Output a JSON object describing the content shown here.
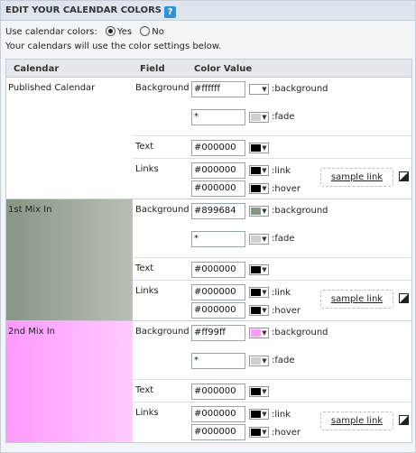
{
  "header": {
    "title": "EDIT YOUR CALENDAR COLORS",
    "help_icon": "?"
  },
  "use_colors": {
    "label": "Use calendar colors:",
    "yes": "Yes",
    "no": "No",
    "selected": "Yes"
  },
  "note": "Your calendars will use the color settings below.",
  "columns": {
    "calendar": "Calendar",
    "field": "Field",
    "value": "Color Value"
  },
  "field_labels": {
    "background": "Background",
    "text": "Text",
    "links": "Links"
  },
  "suffix": {
    "background": ":background",
    "fade": ":fade",
    "link": ":link",
    "hover": ":hover"
  },
  "sample_link": "sample link",
  "calendars": [
    {
      "name": "Published Calendar",
      "background": "#ffffff",
      "fade": "*",
      "text": "#000000",
      "link": "#000000",
      "hover": "#000000",
      "swatch_background": "#ffffff",
      "swatch_fade": "#cfcfcf",
      "swatch_text": "#000000",
      "swatch_link": "#000000",
      "swatch_hover": "#000000",
      "gradient": [
        "#ffffff",
        "#ffffff"
      ]
    },
    {
      "name": "1st Mix In",
      "background": "#899684",
      "fade": "*",
      "text": "#000000",
      "link": "#000000",
      "hover": "#000000",
      "swatch_background": "#899684",
      "swatch_fade": "#cfcfcf",
      "swatch_text": "#000000",
      "swatch_link": "#000000",
      "swatch_hover": "#000000",
      "gradient": [
        "#899684",
        "#b9bfb5"
      ]
    },
    {
      "name": "2nd Mix In",
      "background": "#ff99ff",
      "fade": "*",
      "text": "#000000",
      "link": "#000000",
      "hover": "#000000",
      "swatch_background": "#ff99ff",
      "swatch_fade": "#cfcfcf",
      "swatch_text": "#000000",
      "swatch_link": "#000000",
      "swatch_hover": "#000000",
      "gradient": [
        "#ff99ff",
        "#ffccff"
      ]
    }
  ]
}
